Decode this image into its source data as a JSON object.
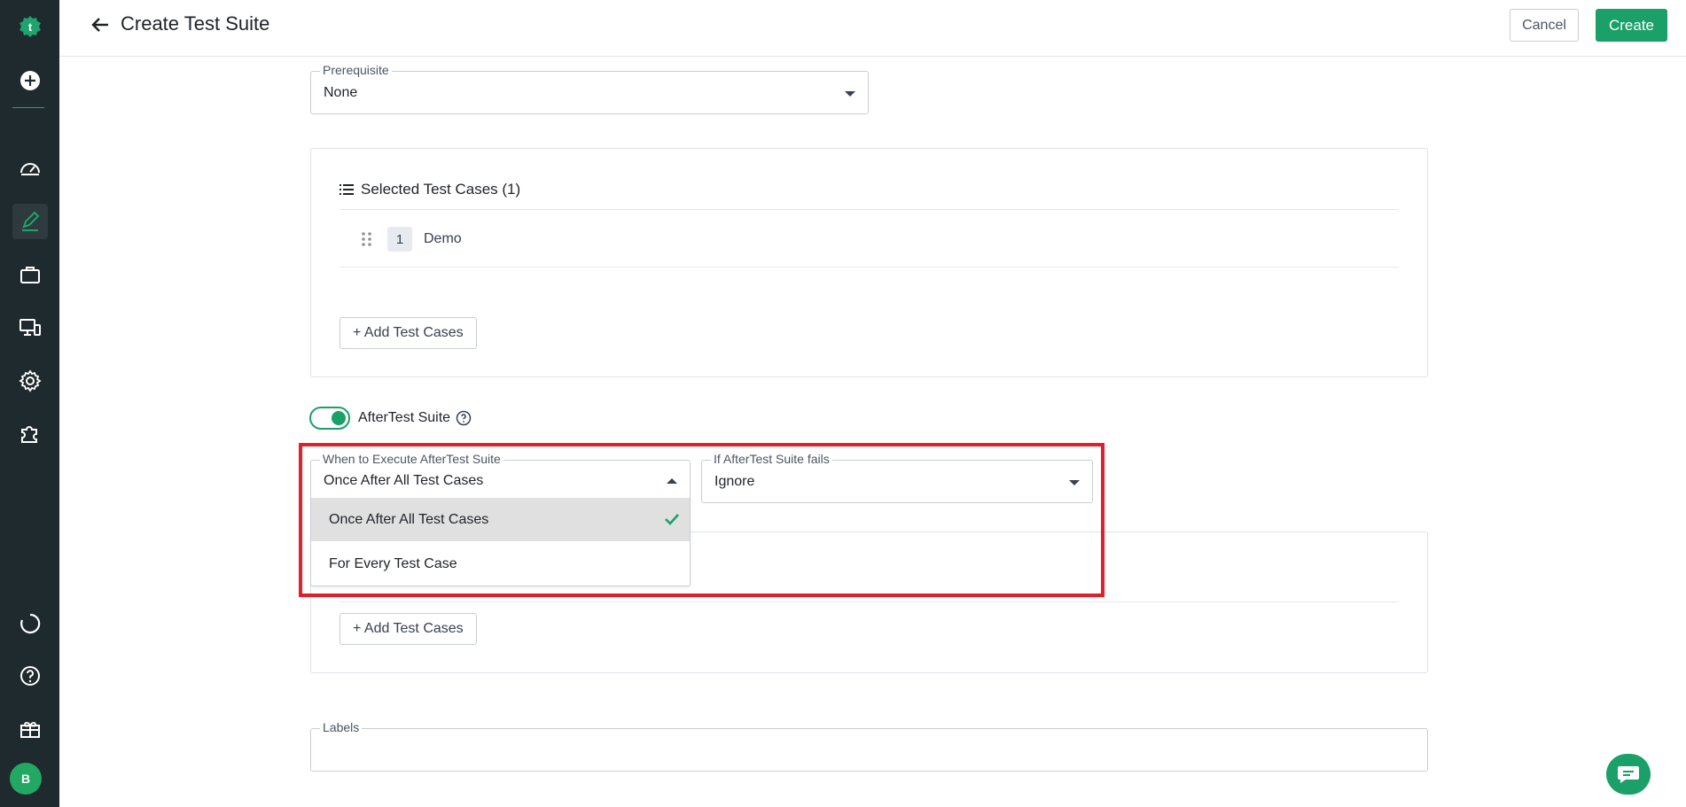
{
  "app": {
    "accent_color": "#1aa068",
    "sidebar_color": "#1f2a2e"
  },
  "header": {
    "title": "Create Test Suite",
    "cancel_label": "Cancel",
    "create_label": "Create"
  },
  "sidebar": {
    "avatar_initial": "B",
    "items": [
      {
        "icon": "logo-icon"
      },
      {
        "icon": "add-icon"
      },
      {
        "icon": "dashboard-icon"
      },
      {
        "icon": "edit-icon",
        "active": true
      },
      {
        "icon": "briefcase-icon"
      },
      {
        "icon": "devices-icon"
      },
      {
        "icon": "gear-icon"
      },
      {
        "icon": "puzzle-icon"
      },
      {
        "icon": "loading-icon"
      },
      {
        "icon": "help-icon"
      },
      {
        "icon": "gift-icon"
      }
    ]
  },
  "prerequisite": {
    "label": "Prerequisite",
    "value": "None"
  },
  "selected_cases": {
    "title": "Selected Test Cases (1)",
    "rows": [
      {
        "index": "1",
        "name": "Demo"
      }
    ],
    "add_label": "+ Add Test Cases"
  },
  "after_suite": {
    "toggle_label": "AfterTest Suite",
    "toggle_on": true,
    "when_label": "When to Execute AfterTest Suite",
    "when_value": "Once After All Test Cases",
    "fails_label": "If AfterTest Suite fails",
    "fails_value": "Ignore",
    "options": [
      "Once After All Test Cases",
      "For Every Test Case"
    ],
    "add_label": "+ Add Test Cases"
  },
  "labels_field": {
    "label": "Labels"
  }
}
